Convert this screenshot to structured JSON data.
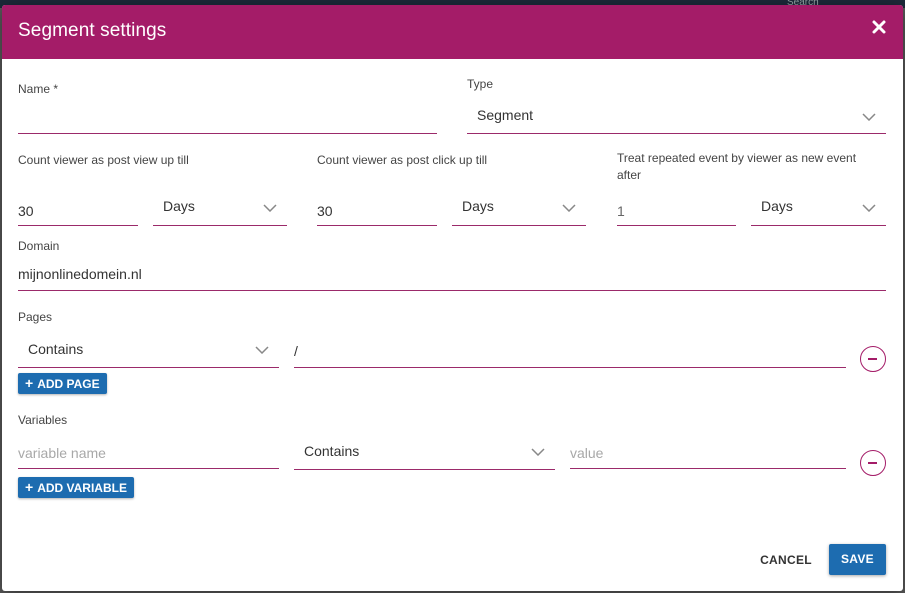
{
  "backdrop": {
    "search_hint": "Search"
  },
  "modal": {
    "title": "Segment settings",
    "close_icon": "close-icon",
    "name": {
      "label": "Name *",
      "value": ""
    },
    "type": {
      "label": "Type",
      "value": "Segment"
    },
    "post_view": {
      "label": "Count viewer as post view up till",
      "value": "30",
      "unit": "Days"
    },
    "post_click": {
      "label": "Count viewer as post click up till",
      "value": "30",
      "unit": "Days"
    },
    "repeat_event": {
      "label": "Treat repeated event by viewer as new event after",
      "value": "1",
      "unit": "Days"
    },
    "domain": {
      "label": "Domain",
      "value": "mijnonlinedomein.nl"
    },
    "pages": {
      "label": "Pages",
      "rows": [
        {
          "match": "Contains",
          "value": "/"
        }
      ],
      "add_label": "ADD PAGE"
    },
    "variables": {
      "label": "Variables",
      "rows": [
        {
          "name_placeholder": "variable name",
          "match": "Contains",
          "value_placeholder": "value"
        }
      ],
      "add_label": "ADD VARIABLE"
    },
    "cancel_label": "CANCEL",
    "save_label": "SAVE"
  },
  "colors": {
    "header": "#a41c68",
    "primary_button": "#1d6cb0",
    "underline": "#9b2a6a"
  }
}
